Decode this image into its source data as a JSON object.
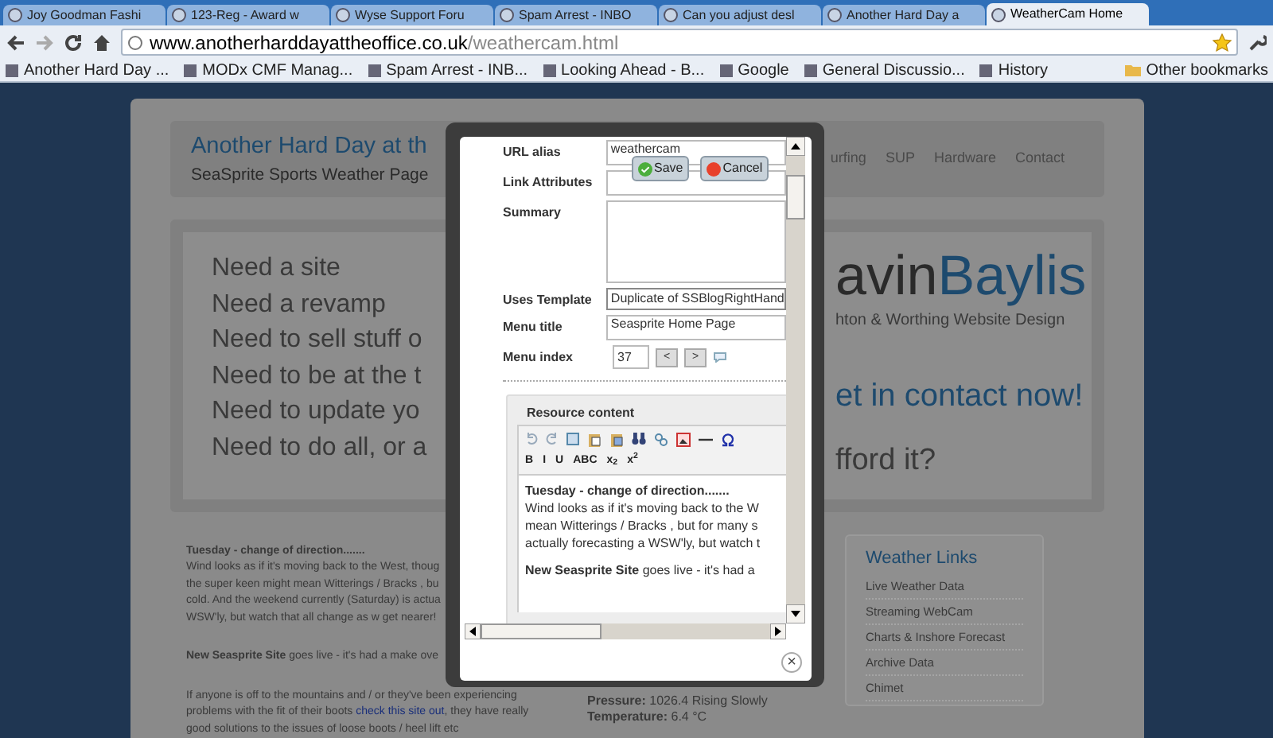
{
  "browser": {
    "tabs": [
      {
        "title": "Joy Goodman Fashi",
        "selected": false
      },
      {
        "title": "123-Reg - Award w",
        "selected": false
      },
      {
        "title": "Wyse Support Foru",
        "selected": false
      },
      {
        "title": "Spam Arrest - INBO",
        "selected": false
      },
      {
        "title": "Can you adjust desl",
        "selected": false
      },
      {
        "title": "Another Hard Day a",
        "selected": false
      },
      {
        "title": "WeatherCam Home",
        "selected": true
      }
    ],
    "url": {
      "host": "www.anotherharddayattheoffice.co.uk",
      "path": "/weathercam.html"
    },
    "bookmarks": [
      "Another Hard Day ...",
      "MODx CMF Manag...",
      "Spam Arrest - INB...",
      "Looking Ahead - B...",
      "Google",
      "General Discussio...",
      "History"
    ],
    "other_bookmarks": "Other bookmarks"
  },
  "site": {
    "title": "Another Hard Day at th",
    "subtitle": "SeaSprite Sports Weather Page",
    "nav": [
      "urfing",
      "SUP",
      "Hardware",
      "Contact"
    ],
    "banner_lines": [
      "Need a site",
      "Need a revamp",
      "Need to sell stuff o",
      "Need to be at the t",
      "Need to update yo",
      "Need to do all, or a"
    ],
    "brand_dark": "avin",
    "brand_blue": "Baylis",
    "tagline": "hton & Worthing Website Design",
    "contact": "et in contact now!",
    "afford": "fford it?",
    "posts": [
      {
        "kind": "lines",
        "lines": [
          "**Tuesday - change of direction.......**",
          "Wind looks as if it's moving back to the West, thoug",
          "the super keen might mean Witterings / Bracks , bu",
          "cold. And the weekend currently (Saturday) is actua",
          "WSW'ly, but watch that all change as w get nearer!"
        ]
      },
      {
        "kind": "lines",
        "lines": [
          "**New Seasprite Site** goes live - it's had a make ove"
        ]
      },
      {
        "kind": "link",
        "before": "If anyone is off to the mountains and / or they've been experiencing problems with the fit of their boots ",
        "link": "check this site out",
        "after": ", they have really good solutions to the issues of loose boots / heel lift etc"
      }
    ],
    "weather": [
      "**Pressure:** 1026.4 Rising Slowly",
      "**Temperature:** 6.4 °C"
    ],
    "links_title": "Weather Links",
    "links": [
      "Live Weather Data",
      "Streaming WebCam",
      "Charts & Inshore Forecast",
      "Archive Data",
      "Chimet"
    ]
  },
  "dialog": {
    "fields": [
      {
        "kind": "text",
        "label": "URL alias",
        "value": "weathercam"
      },
      {
        "kind": "text",
        "label": "Link Attributes"
      },
      {
        "kind": "textarea",
        "label": "Summary"
      },
      {
        "kind": "select",
        "label": "Uses Template",
        "value": "Duplicate of SSBlogRightHand"
      },
      {
        "kind": "text",
        "label": "Menu title",
        "value": "Seasprite Home Page"
      },
      {
        "kind": "index",
        "label": "Menu index",
        "value": "37",
        "prev": "<",
        "next": ">"
      }
    ],
    "save": "Save",
    "cancel": "Cancel",
    "content_title": "Resource content",
    "format_buttons": [
      "B",
      "I",
      "U",
      "ABC",
      "x$_{2}$",
      "x$^{2}$"
    ],
    "content": [
      [
        "**Tuesday - change of direction.......**",
        "Wind looks as if it's moving back to the W",
        "mean Witterings / Bracks , but for many s",
        "actually forecasting a WSW'ly, but watch t"
      ],
      [
        "**New Seasprite Site** goes live - it's had a"
      ]
    ],
    "close": "×"
  }
}
